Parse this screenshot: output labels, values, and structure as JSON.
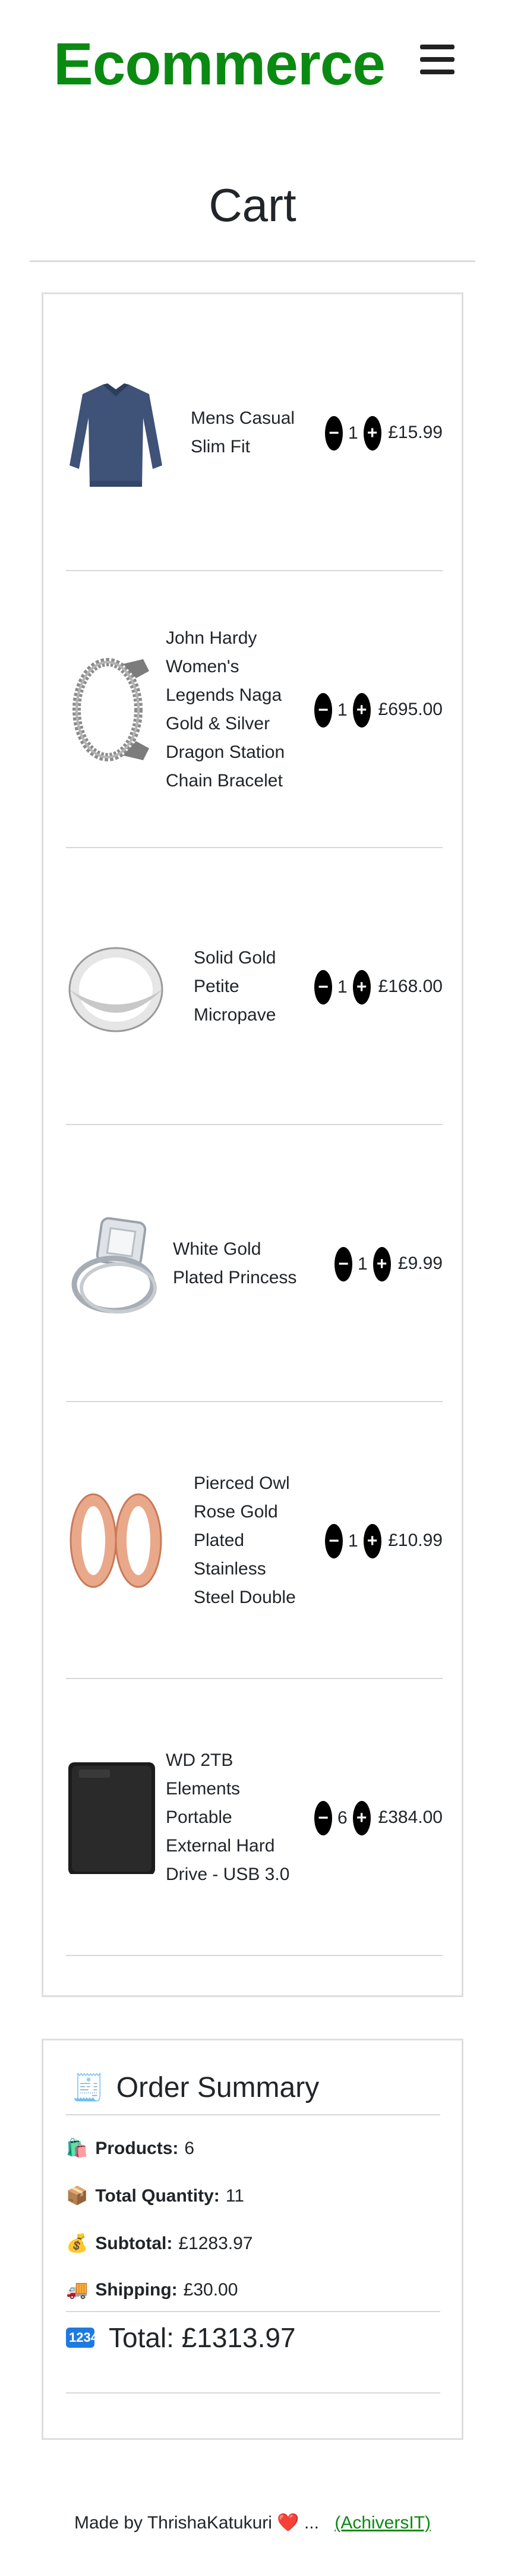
{
  "header": {
    "brand": "Ecommerce"
  },
  "page": {
    "title": "Cart"
  },
  "cart": {
    "items": [
      {
        "name": "Mens Casual Slim Fit",
        "qty": "1",
        "price": "£15.99",
        "minus": "−",
        "plus": "+"
      },
      {
        "name": "John Hardy Women's Legends Naga Gold & Silver Dragon Station Chain Bracelet",
        "qty": "1",
        "price": "£695.00",
        "minus": "−",
        "plus": "+"
      },
      {
        "name": "Solid Gold Petite Micropave",
        "qty": "1",
        "price": "£168.00",
        "minus": "−",
        "plus": "+"
      },
      {
        "name": "White Gold Plated Princess",
        "qty": "1",
        "price": "£9.99",
        "minus": "−",
        "plus": "+"
      },
      {
        "name": "Pierced Owl Rose Gold Plated Stainless Steel Double",
        "qty": "1",
        "price": "£10.99",
        "minus": "−",
        "plus": "+"
      },
      {
        "name": "WD 2TB Elements Portable External Hard Drive - USB 3.0",
        "qty": "6",
        "price": "£384.00",
        "minus": "−",
        "plus": "+"
      }
    ]
  },
  "summary": {
    "icon": "🧾",
    "title": "Order Summary",
    "products_icon": "🛍️",
    "products_label": "Products:",
    "products_value": "6",
    "quantity_icon": "📦",
    "quantity_label": "Total Quantity:",
    "quantity_value": "11",
    "subtotal_icon": "💰",
    "subtotal_label": "Subtotal:",
    "subtotal_value": "£1283.97",
    "shipping_icon": "🚚",
    "shipping_label": "Shipping:",
    "shipping_value": "£30.00",
    "total_icon": "1234",
    "total_text": "Total: £1313.97"
  },
  "footer": {
    "made_by": "Made by ThrishaKatukuri",
    "heart": "❤️",
    "ellipsis": "...",
    "link": "(AchiversIT)"
  }
}
